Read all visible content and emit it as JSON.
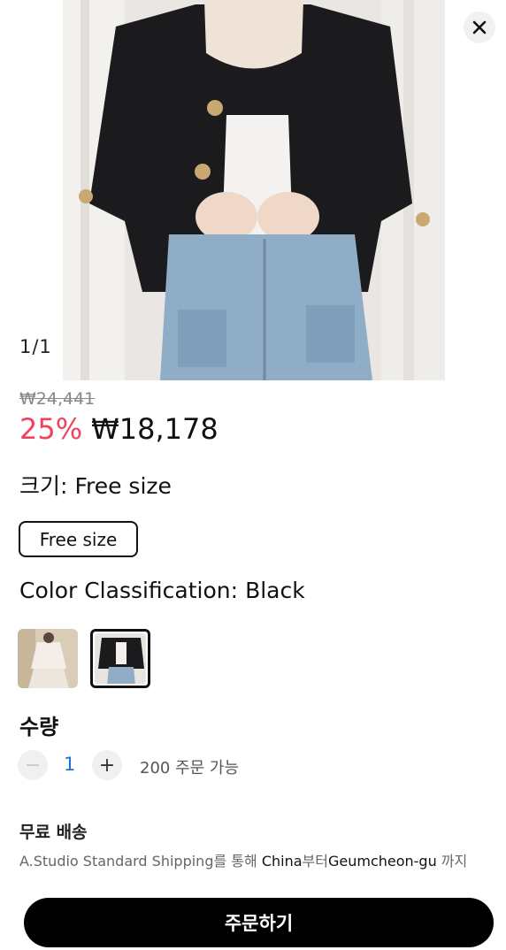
{
  "gallery": {
    "counter": "1/1",
    "image_alt": "Black tweed cropped jacket with denim jeans"
  },
  "price": {
    "original": "₩24,441",
    "discount": "25%",
    "sale": "₩18,178"
  },
  "size": {
    "label": "크기:",
    "selected": "Free size",
    "options": [
      "Free size"
    ]
  },
  "color": {
    "label": "Color Classification:",
    "selected": "Black",
    "options": [
      "White",
      "Black"
    ]
  },
  "quantity": {
    "label": "수량",
    "minus": "−",
    "value": "1",
    "plus": "+",
    "available": "200 주문 가능"
  },
  "shipping": {
    "title": "무료 배송",
    "p1": "A.Studio Standard Shipping",
    "p2": "를 통해 ",
    "p3": "China",
    "p4": "부터",
    "p5": "Geumcheon-gu",
    "p6": " 까지"
  },
  "order_button": "주문하기",
  "colors": {
    "accent_red": "#f0425d",
    "qty_blue": "#1a73d9",
    "button_black": "#000000"
  }
}
